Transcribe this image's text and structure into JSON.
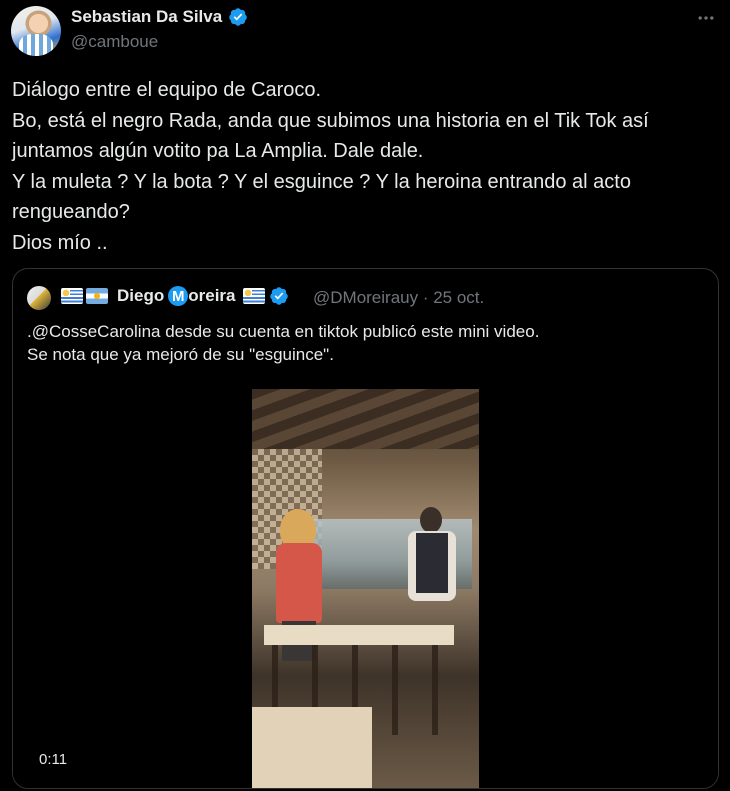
{
  "author": {
    "name": "Sebastian Da Silva",
    "handle": "@camboue",
    "verified_icon": "verified-badge-icon"
  },
  "tweet": {
    "text": "Diálogo entre el equipo de Caroco.\nBo, está el negro Rada, anda que subimos una historia en el Tik Tok así juntamos algún votito pa La Amplia. Dale dale.\nY la muleta ? Y la bota ? Y el esguince ? Y la heroina entrando al acto rengueando?\nDios mío .."
  },
  "quoted": {
    "name_first": "Diego",
    "name_m": "M",
    "name_rest": "oreira",
    "handle_date": "@DMoreirauy · 25 oct.",
    "text": ".@CosseCarolina desde su cuenta en tiktok publicó este mini video.\nSe nota que ya mejoró de su \"esguince\".",
    "video_duration": "0:11"
  },
  "colors": {
    "background": "#000000",
    "text": "#e7e9ea",
    "muted": "#71767b",
    "accent": "#1d9bf0",
    "border": "#2f3336"
  }
}
